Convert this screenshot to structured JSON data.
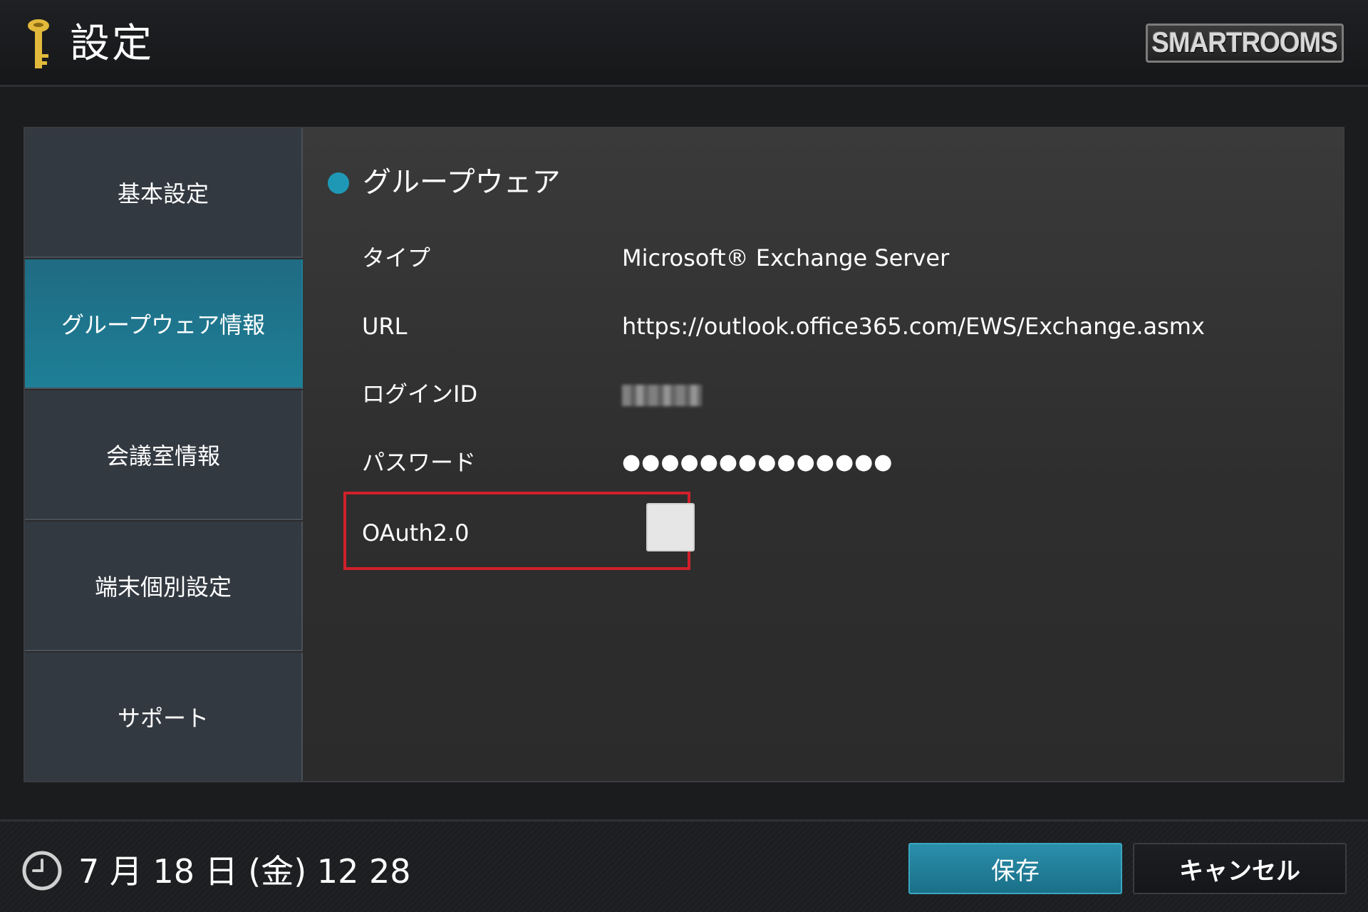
{
  "header": {
    "title": "設定",
    "key_icon": "key-icon",
    "logo_text": "SMARTROOMS"
  },
  "sidebar": {
    "items": [
      {
        "label": "基本設定",
        "active": false
      },
      {
        "label": "グループウェア情報",
        "active": true
      },
      {
        "label": "会議室情報",
        "active": false
      },
      {
        "label": "端末個別設定",
        "active": false
      },
      {
        "label": "サポート",
        "active": false
      }
    ]
  },
  "panel": {
    "section_title": "グループウェア",
    "fields": {
      "type": {
        "label": "タイプ",
        "value": "Microsoft® Exchange Server"
      },
      "url": {
        "label": "URL",
        "value": "https://outlook.office365.com/EWS/Exchange.asmx"
      },
      "login_id": {
        "label": "ログインID",
        "value": "dummy"
      },
      "password": {
        "label": "パスワード",
        "value": "●●●●●●●●●●●●●●"
      },
      "oauth": {
        "label": "OAuth2.0",
        "checked": false
      }
    }
  },
  "footer": {
    "clock_icon": "clock-icon",
    "datetime": "7 月 18 日 (金)   12 28",
    "save_label": "保存",
    "cancel_label": "キャンセル"
  },
  "colors": {
    "accent": "#1f98b6",
    "active_nav": "#1e7f96",
    "highlight": "#d0202a",
    "key": "#e2b93b"
  }
}
